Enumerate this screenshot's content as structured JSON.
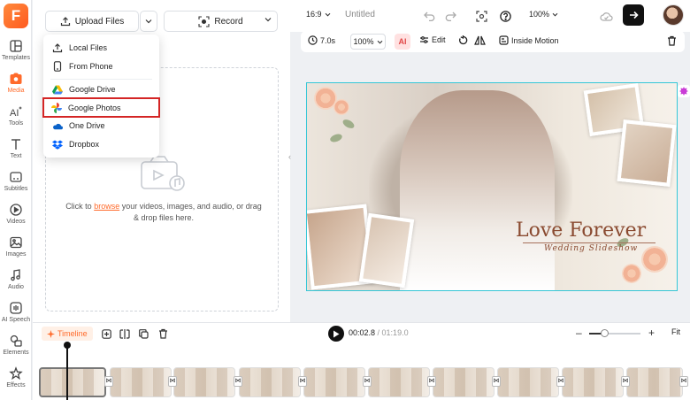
{
  "rail": {
    "logo": "F",
    "items": [
      {
        "label": "Templates",
        "icon": "templates-icon"
      },
      {
        "label": "Media",
        "icon": "media-icon",
        "active": true
      },
      {
        "label": "Tools",
        "icon": "ai-tools-icon"
      },
      {
        "label": "Text",
        "icon": "text-icon"
      },
      {
        "label": "Subtitles",
        "icon": "subtitles-icon"
      },
      {
        "label": "Videos",
        "icon": "videos-icon"
      },
      {
        "label": "Images",
        "icon": "images-icon"
      },
      {
        "label": "Audio",
        "icon": "audio-icon"
      },
      {
        "label": "AI Speech",
        "icon": "ai-speech-icon"
      },
      {
        "label": "Elements",
        "icon": "elements-icon"
      },
      {
        "label": "Effects",
        "icon": "effects-icon"
      }
    ]
  },
  "panel": {
    "upload_label": "Upload Files",
    "record_label": "Record",
    "dropzone_prefix": "Click to ",
    "dropzone_link": "browse",
    "dropzone_suffix": " your videos, images, and audio, or drag & drop files here."
  },
  "upload_menu": {
    "items": [
      {
        "label": "Local Files",
        "icon": "upload-icon"
      },
      {
        "label": "From Phone",
        "icon": "phone-icon"
      },
      {
        "label": "Google Drive",
        "icon": "google-drive-icon"
      },
      {
        "label": "Google Photos",
        "icon": "google-photos-icon",
        "highlighted": true
      },
      {
        "label": "One Drive",
        "icon": "onedrive-icon"
      },
      {
        "label": "Dropbox",
        "icon": "dropbox-icon"
      }
    ]
  },
  "topbar": {
    "aspect_ratio": "16:9",
    "project_title": "Untitled",
    "zoom": "100%"
  },
  "edit_toolbar": {
    "duration": "7.0s",
    "scale": "100%",
    "ai_label": "AI",
    "edit_label": "Edit",
    "inside_motion_label": "Inside Motion"
  },
  "canvas": {
    "title": "Love Forever",
    "subtitle": "Wedding Slideshow",
    "accent": "#35c6d6"
  },
  "timeline": {
    "tab_label": "Timeline",
    "current_time": "00:02.8",
    "separator": " / ",
    "total_time": "01:19.0",
    "zoom_level": 0.3,
    "fit_label": "Fit"
  },
  "colors": {
    "brand": "#ff6a2a",
    "highlight_box": "#d42525"
  }
}
